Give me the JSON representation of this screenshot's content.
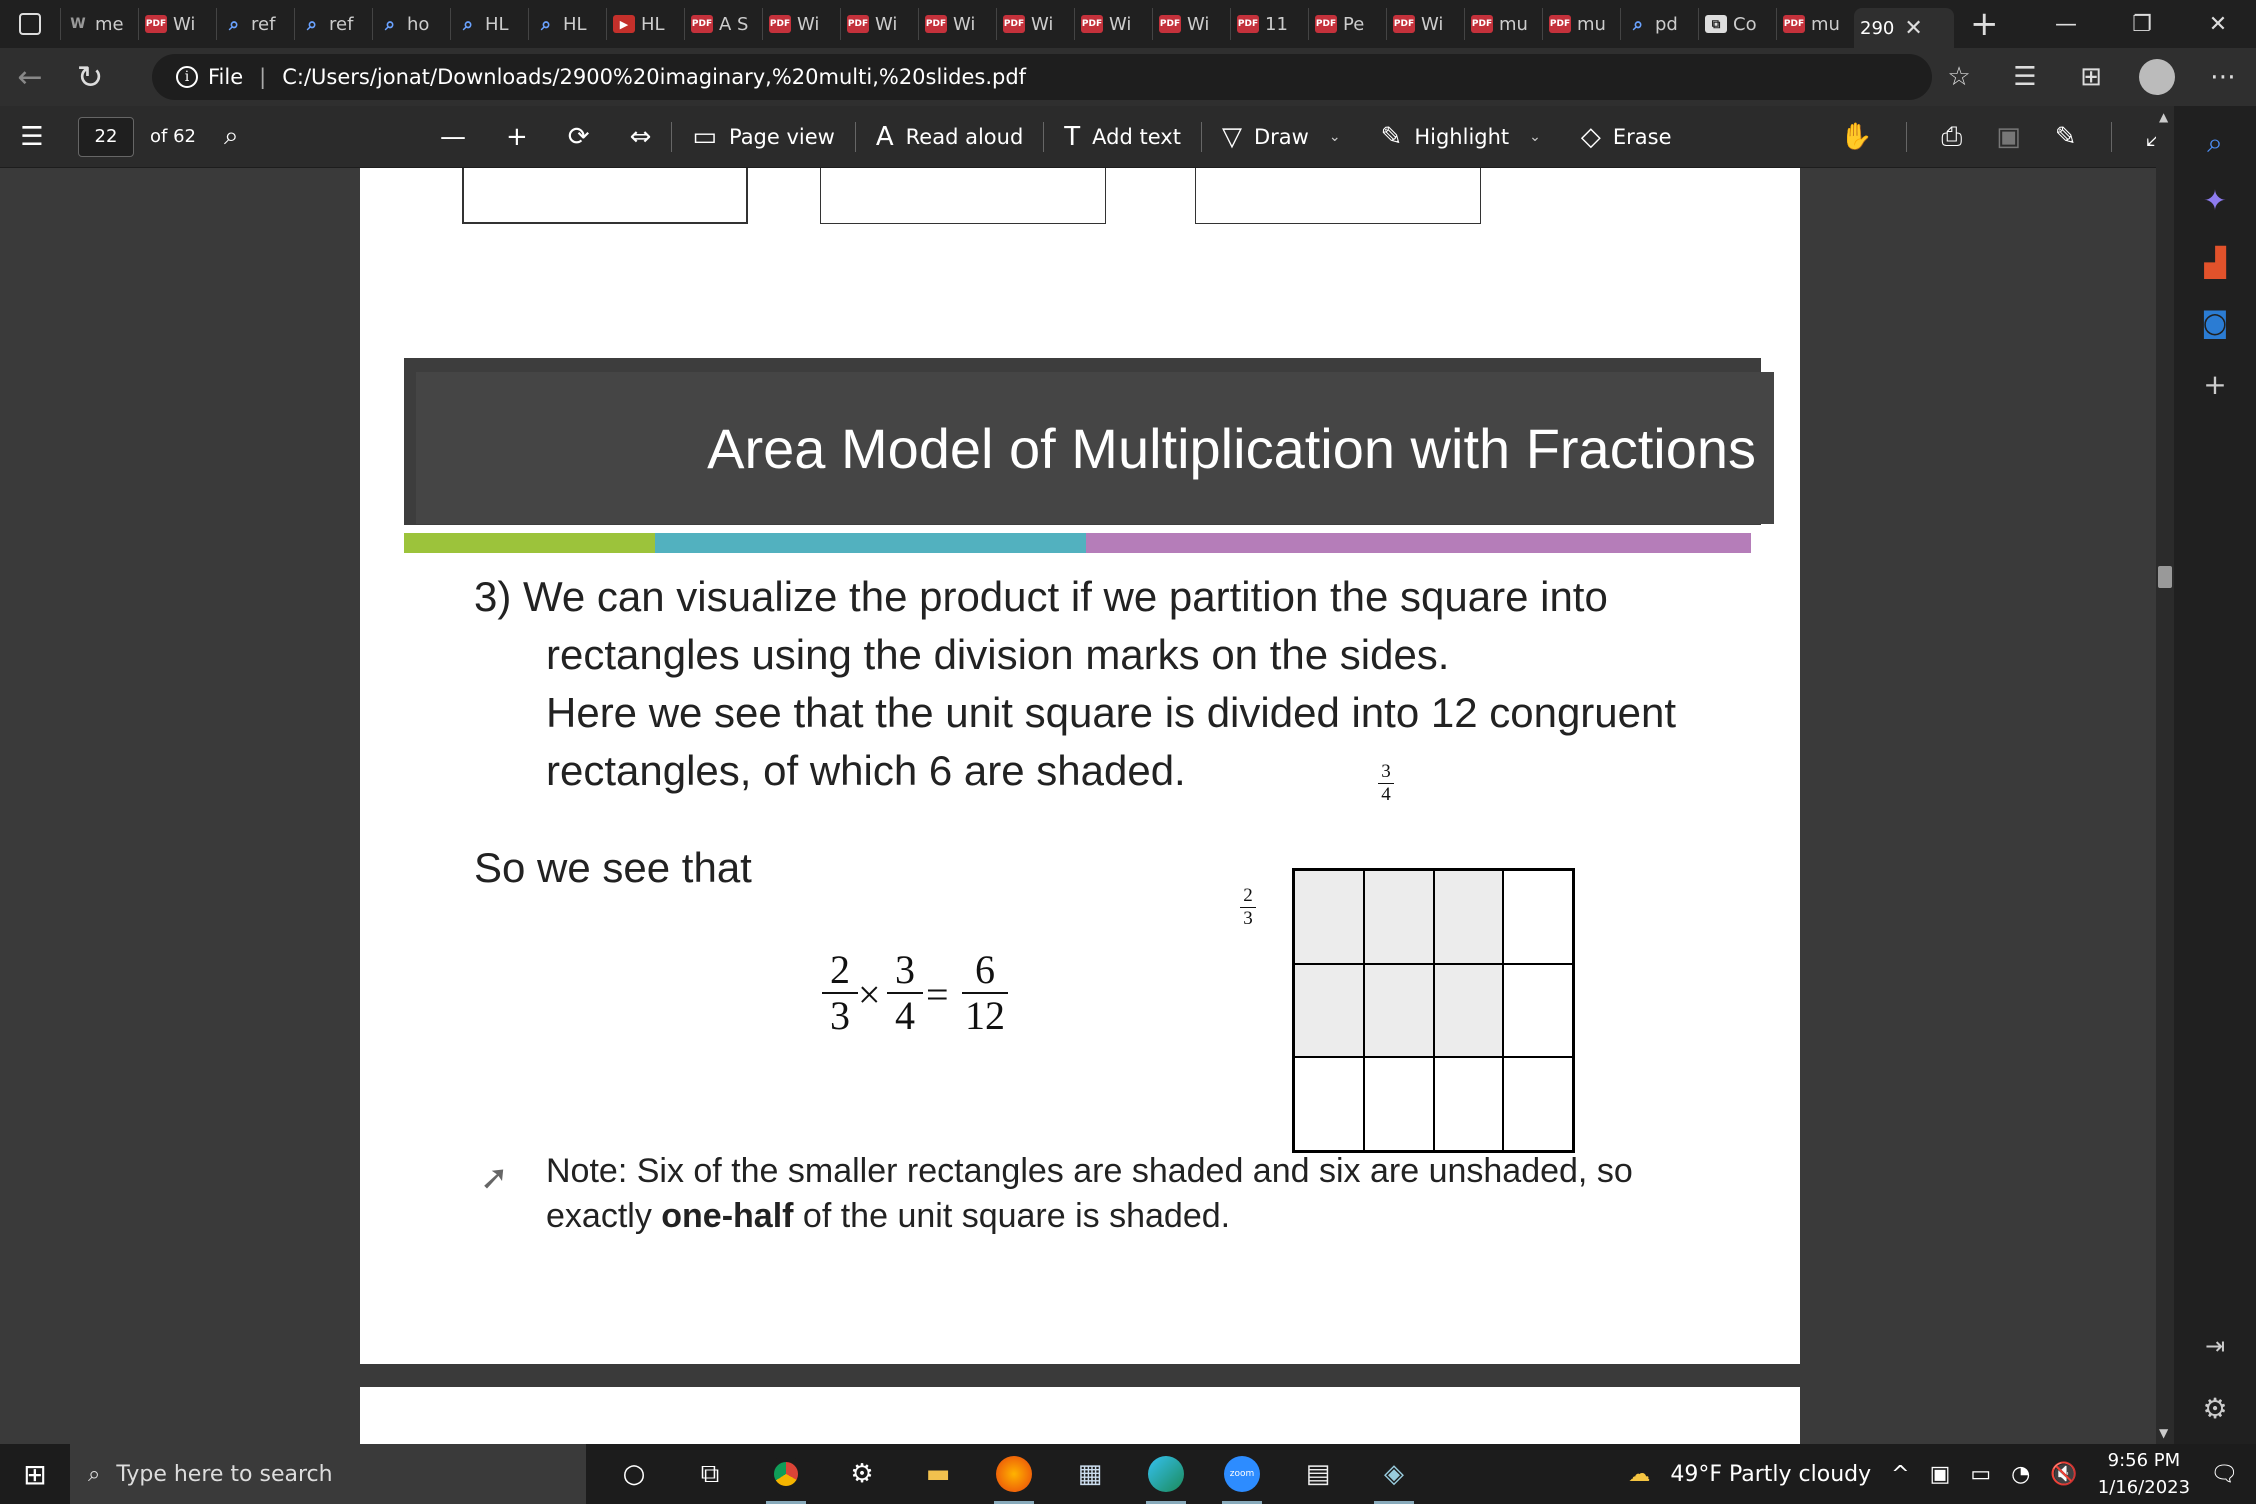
{
  "browser": {
    "tabs": [
      {
        "label": "me",
        "favicon": "wiki"
      },
      {
        "label": "Wi",
        "favicon": "pdf"
      },
      {
        "label": "ref",
        "favicon": "search"
      },
      {
        "label": "ref",
        "favicon": "search"
      },
      {
        "label": "ho",
        "favicon": "search"
      },
      {
        "label": "HL",
        "favicon": "search"
      },
      {
        "label": "HL",
        "favicon": "search"
      },
      {
        "label": "HL",
        "favicon": "yt"
      },
      {
        "label": "A S",
        "favicon": "pdf"
      },
      {
        "label": "Wi",
        "favicon": "pdf"
      },
      {
        "label": "Wi",
        "favicon": "pdf"
      },
      {
        "label": "Wi",
        "favicon": "pdf"
      },
      {
        "label": "Wi",
        "favicon": "pdf"
      },
      {
        "label": "Wi",
        "favicon": "pdf"
      },
      {
        "label": "Wi",
        "favicon": "pdf"
      },
      {
        "label": "11",
        "favicon": "pdf"
      },
      {
        "label": "Pe",
        "favicon": "pdf"
      },
      {
        "label": "Wi",
        "favicon": "pdf"
      },
      {
        "label": "mu",
        "favicon": "pdf"
      },
      {
        "label": "mu",
        "favicon": "pdf"
      },
      {
        "label": "pd",
        "favicon": "search"
      },
      {
        "label": "Co",
        "favicon": "copy"
      },
      {
        "label": "mu",
        "favicon": "pdf"
      }
    ],
    "active_tab": {
      "label": "290",
      "close": "✕"
    },
    "new_tab": "+",
    "window_controls": {
      "minimize": "—",
      "restore": "❐",
      "close": "✕"
    },
    "address": {
      "scheme_label": "File",
      "url": "C:/Users/jonat/Downloads/2900%20imaginary,%20multi,%20slides.pdf"
    }
  },
  "pdf_toolbar": {
    "page_number": "22",
    "page_total": "of 62",
    "tools": [
      {
        "label": "",
        "icon": "—"
      },
      {
        "label": "",
        "icon": "+"
      },
      {
        "label": "",
        "icon": "⟳"
      },
      {
        "label": "",
        "icon": "⇔"
      },
      {
        "label": "Page view",
        "icon": "▭"
      },
      {
        "label": "Read aloud",
        "icon": "A"
      },
      {
        "label": "Add text",
        "icon": "T"
      },
      {
        "label": "Draw",
        "icon": "▽",
        "dropdown": true
      },
      {
        "label": "Highlight",
        "icon": "✎",
        "dropdown": true
      },
      {
        "label": "Erase",
        "icon": "◇"
      }
    ]
  },
  "slide": {
    "title": "Area Model of Multiplication with Fractions",
    "stripe_colors": [
      "#9cc33b",
      "#52b1bf",
      "#b57db9"
    ],
    "para1_lines": [
      "3) We can visualize the product if we partition the square into",
      "rectangles using the division marks on the sides.",
      "Here we see that the unit square is divided into 12 congruent",
      "rectangles, of which 6 are shaded."
    ],
    "so_text": "So we see that",
    "equation": {
      "f1": {
        "num": "2",
        "den": "3"
      },
      "times": "×",
      "f2": {
        "num": "3",
        "den": "4"
      },
      "equals": "=",
      "f3": {
        "num": "6",
        "den": "12"
      }
    },
    "top_label": {
      "num": "3",
      "den": "4"
    },
    "side_label": {
      "num": "2",
      "den": "3"
    },
    "grid": {
      "rows": 3,
      "cols": 4,
      "shaded_rows": 2,
      "shaded_cols": 3
    },
    "note_prefix": "Note:  Six of the smaller rectangles are shaded and six are unshaded, so",
    "note_line2_before": "exactly ",
    "note_bold": "one-half",
    "note_line2_after": " of the unit square is shaded."
  },
  "taskbar": {
    "search_placeholder": "Type here to search",
    "weather": "49°F  Partly cloudy",
    "time": "9:56 PM",
    "date": "1/16/2023"
  }
}
